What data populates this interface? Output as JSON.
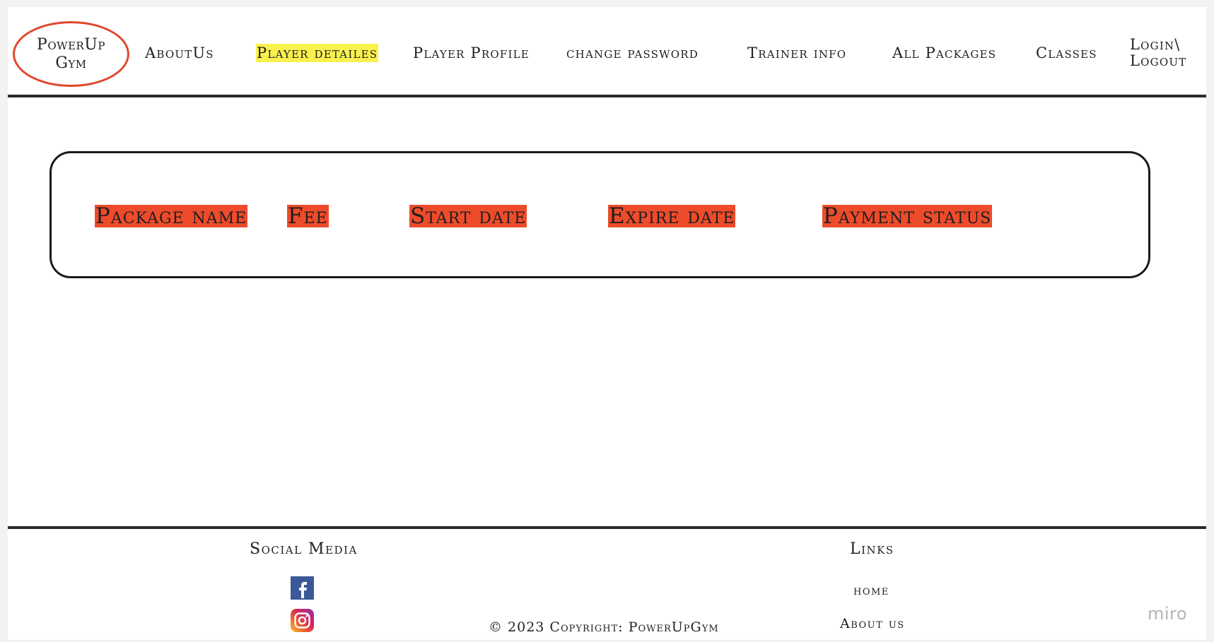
{
  "header": {
    "logo": {
      "line1": "PowerUp",
      "line2": "Gym"
    },
    "nav": [
      {
        "label": "AboutUs"
      },
      {
        "label": "Player detailes",
        "active": true
      },
      {
        "label": "Player Profile"
      },
      {
        "label": "change password"
      },
      {
        "label": "Trainer info"
      },
      {
        "label": "All Packages"
      },
      {
        "label": "Classes"
      }
    ],
    "login": {
      "line1": "Login\\",
      "line2": "Logout"
    }
  },
  "table": {
    "columns": [
      "Package name",
      "Fee",
      "Start date",
      "Expire date",
      "Payment status"
    ]
  },
  "footer": {
    "social_heading": "Social Media",
    "social_icons": [
      "facebook-icon",
      "instagram-icon"
    ],
    "links_heading": "Links",
    "links": [
      "home",
      "About us"
    ],
    "copyright": "© 2023 Copyright: PowerUpGym"
  },
  "watermark": "miro",
  "colors": {
    "logo_border": "#e0482c",
    "active_highlight": "#f9f24e",
    "header_cell": "#ee4b2b",
    "facebook": "#3b5998"
  }
}
